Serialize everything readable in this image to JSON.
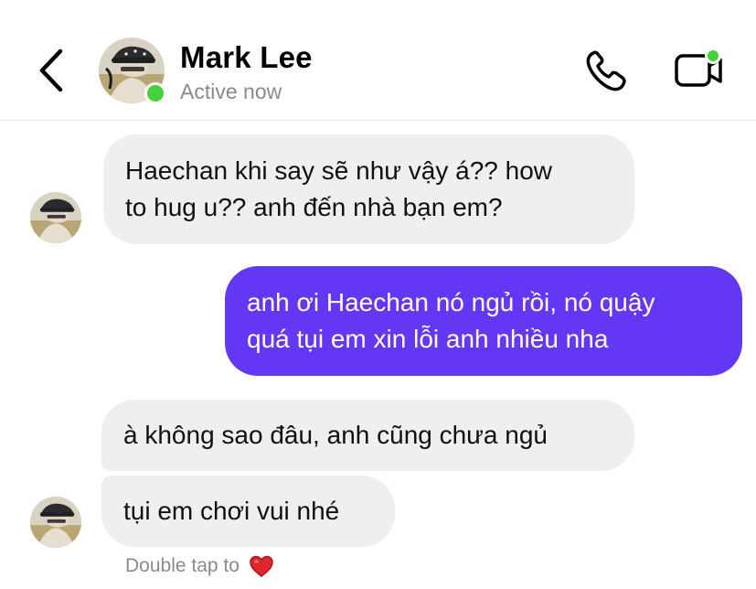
{
  "header": {
    "contact_name": "Mark Lee",
    "status": "Active now",
    "online_color": "#44d13a",
    "icons": {
      "back": "chevron-left-icon",
      "call": "phone-icon",
      "video": "video-camera-icon"
    }
  },
  "messages": [
    {
      "direction": "incoming",
      "text": "Haechan khi say sẽ như vậy á?? how to hug u?? anh đến nhà bạn em?",
      "lines": [
        "Haechan khi say sẽ như vậy á?? how",
        "to hug u?? anh đến nhà bạn em?"
      ]
    },
    {
      "direction": "outgoing",
      "text": "anh ơi Haechan nó ngủ rồi, nó quậy quá tụi em xin lỗi anh nhiều nha",
      "lines": [
        "anh ơi Haechan nó ngủ rồi, nó quậy",
        "quá tụi em xin lỗi anh nhiều nha"
      ]
    },
    {
      "direction": "incoming",
      "text": "à không sao đâu, anh cũng chưa ngủ"
    },
    {
      "direction": "incoming",
      "text": "tụi em chơi vui nhé"
    }
  ],
  "reaction_hint": {
    "text": "Double tap to",
    "icon": "red-heart-icon"
  },
  "colors": {
    "incoming_bubble": "#efeff0",
    "outgoing_bubble": "#6437f5",
    "secondary_text": "#8a8a8e"
  }
}
